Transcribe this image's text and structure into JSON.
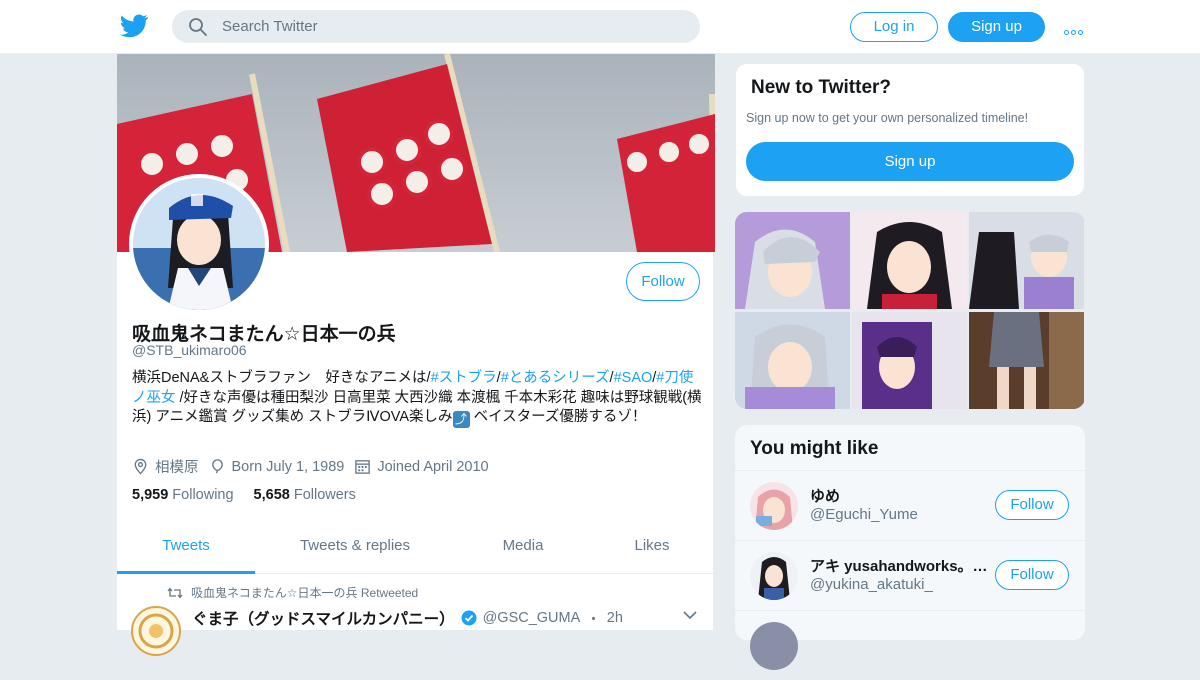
{
  "topbar": {
    "logo_icon": "twitter-bird-icon",
    "search_placeholder": "Search Twitter",
    "login_label": "Log in",
    "signup_label": "Sign up",
    "more_icon": "more-dots-icon",
    "accent_color": "#1da1f2"
  },
  "profile": {
    "name": "吸血鬼ネコまたん☆日本一の兵",
    "handle": "@STB_ukimaro06",
    "follow_label": "Follow",
    "bio": {
      "p1": "横浜DeNA&ストブラファン　好きなアニメは/",
      "t1": "#ストブラ",
      "s1": "/",
      "t2": "#とあるシリーズ",
      "s2": "/",
      "t3": "#SAO",
      "s3": "/",
      "t4": "#刀使ノ巫女",
      "p2": " /好きな声優は種田梨沙 日高里菜 大西沙織 本渡楓 千本木彩花 趣味は野球観戦(横浜) アニメ鑑賞 グッズ集め ストブラⅣOVA楽しみ",
      "emoji": "⤴",
      "p3": " ベイスターズ優勝するゾ！"
    },
    "location": "相模原",
    "birthday": "Born July 1, 1989",
    "joined": "Joined April 2010",
    "following_count": "5,959",
    "following_label": "Following",
    "followers_count": "5,658",
    "followers_label": "Followers",
    "tabs": [
      {
        "label": "Tweets",
        "active": true
      },
      {
        "label": "Tweets & replies",
        "active": false
      },
      {
        "label": "Media",
        "active": false
      },
      {
        "label": "Likes",
        "active": false
      }
    ]
  },
  "tweet": {
    "retweet_text": "吸血鬼ネコまたん☆日本一の兵 Retweeted",
    "name": "ぐま子（グッドスマイルカンパニー）",
    "handle": "@GSC_GUMA",
    "separator": "・",
    "time": "2h"
  },
  "sidebar": {
    "new_title": "New to Twitter?",
    "new_text": "Sign up now to get your own personalized timeline!",
    "signup_label": "Sign up",
    "might_like_title": "You might like",
    "suggestions": [
      {
        "name": "ゆめ",
        "handle": "@Eguchi_Yume",
        "follow": "Follow"
      },
      {
        "name": "アキ yusahandworks。…",
        "handle": "@yukina_akatuki_",
        "follow": "Follow"
      }
    ]
  }
}
